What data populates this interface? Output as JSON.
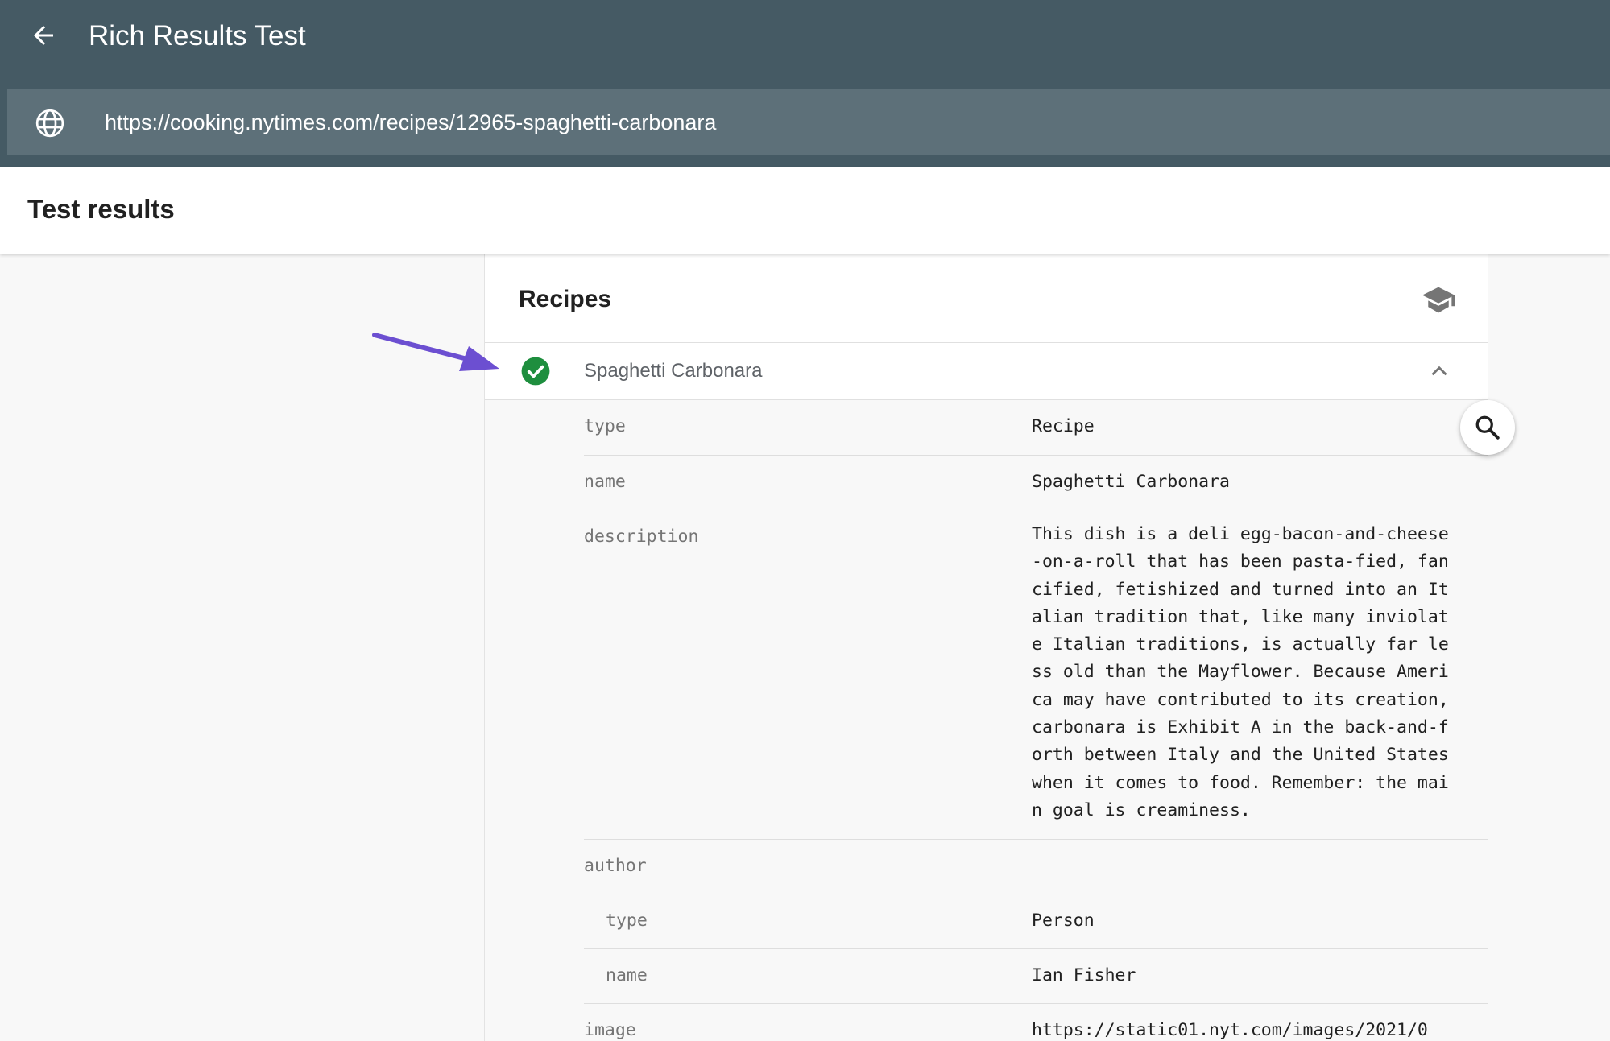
{
  "topbar": {
    "title": "Rich Results Test",
    "back_icon": "arrow-back-icon",
    "url_icon": "globe-icon",
    "url_value": "https://cooking.nytimes.com/recipes/12965-spaghetti-carbonara"
  },
  "results": {
    "title": "Test results"
  },
  "card": {
    "title": "Recipes",
    "learn_icon": "school-icon",
    "item": {
      "name": "Spaghetti Carbonara",
      "status_icon": "check-circle-icon",
      "toggle_icon": "chevron-up-icon"
    },
    "properties": {
      "type": {
        "key": "type",
        "value": "Recipe"
      },
      "name": {
        "key": "name",
        "value": "Spaghetti Carbonara"
      },
      "description": {
        "key": "description",
        "value": "This dish is a deli egg-bacon-and-cheese-on-a-roll that has been pasta-fied, fancified, fetishized and turned into an Italian tradition that, like many inviolate Italian traditions, is actually far less old than the Mayflower. Because America may have contributed to its creation, carbonara is Exhibit A in the back-and-forth between Italy and the United States when it comes to food. Remember: the main goal is creaminess."
      },
      "author": {
        "key": "author",
        "type": {
          "key": "type",
          "value": "Person"
        },
        "name": {
          "key": "name",
          "value": "Ian Fisher"
        }
      },
      "image": {
        "key": "image",
        "value": "https://static01.nyt.com/images/2021/0"
      }
    }
  },
  "fab": {
    "icon": "search-icon"
  },
  "annotation": {
    "icon": "pointer-arrow-icon"
  },
  "colors": {
    "topbar": "#455a64",
    "url_bar": "#5d7079",
    "check": "#1e8e3e",
    "annotation_arrow": "#6c4fd1",
    "page_bg": "#f8f8f8"
  }
}
